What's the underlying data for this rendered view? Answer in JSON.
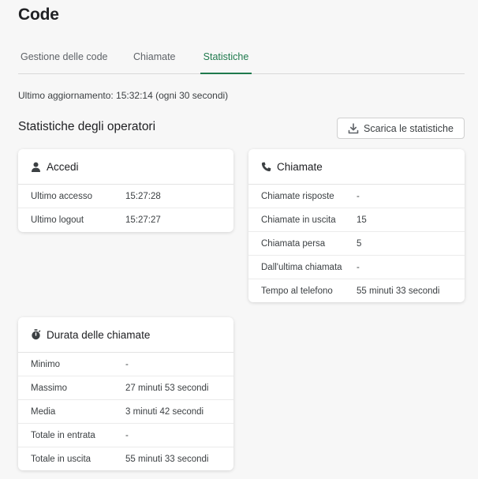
{
  "header": {
    "title": "Code"
  },
  "tabs": [
    {
      "label": "Gestione delle code"
    },
    {
      "label": "Chiamate"
    },
    {
      "label": "Statistiche"
    }
  ],
  "update": {
    "text": "Ultimo aggiornamento: 15:32:14 (ogni 30 secondi)"
  },
  "section": {
    "title": "Statistiche degli operatori"
  },
  "download": {
    "label": "Scarica le statistiche",
    "icon": "download-icon"
  },
  "accedi": {
    "title": "Accedi",
    "icon": "user-icon",
    "rows": [
      {
        "label": "Ultimo accesso",
        "value": "15:27:28"
      },
      {
        "label": "Ultimo logout",
        "value": "15:27:27"
      }
    ]
  },
  "chiamate": {
    "title": "Chiamate",
    "icon": "phone-icon",
    "rows": [
      {
        "label": "Chiamate risposte",
        "value": "-"
      },
      {
        "label": "Chiamate in uscita",
        "value": "15"
      },
      {
        "label": "Chiamata persa",
        "value": "5"
      },
      {
        "label": "Dall'ultima chiamata",
        "value": "-"
      },
      {
        "label": "Tempo al telefono",
        "value": "55 minuti 33 secondi"
      }
    ]
  },
  "durata": {
    "title": "Durata delle chiamate",
    "icon": "stopwatch-icon",
    "rows": [
      {
        "label": "Minimo",
        "value": "-"
      },
      {
        "label": "Massimo",
        "value": "27 minuti 53 secondi"
      },
      {
        "label": "Media",
        "value": "3 minuti 42 secondi"
      },
      {
        "label": "Totale in entrata",
        "value": "-"
      },
      {
        "label": "Totale in uscita",
        "value": "55 minuti 33 secondi"
      }
    ]
  },
  "colors": {
    "accent": "#1f7a4d",
    "background": "#f7f7f7",
    "card": "#ffffff"
  }
}
